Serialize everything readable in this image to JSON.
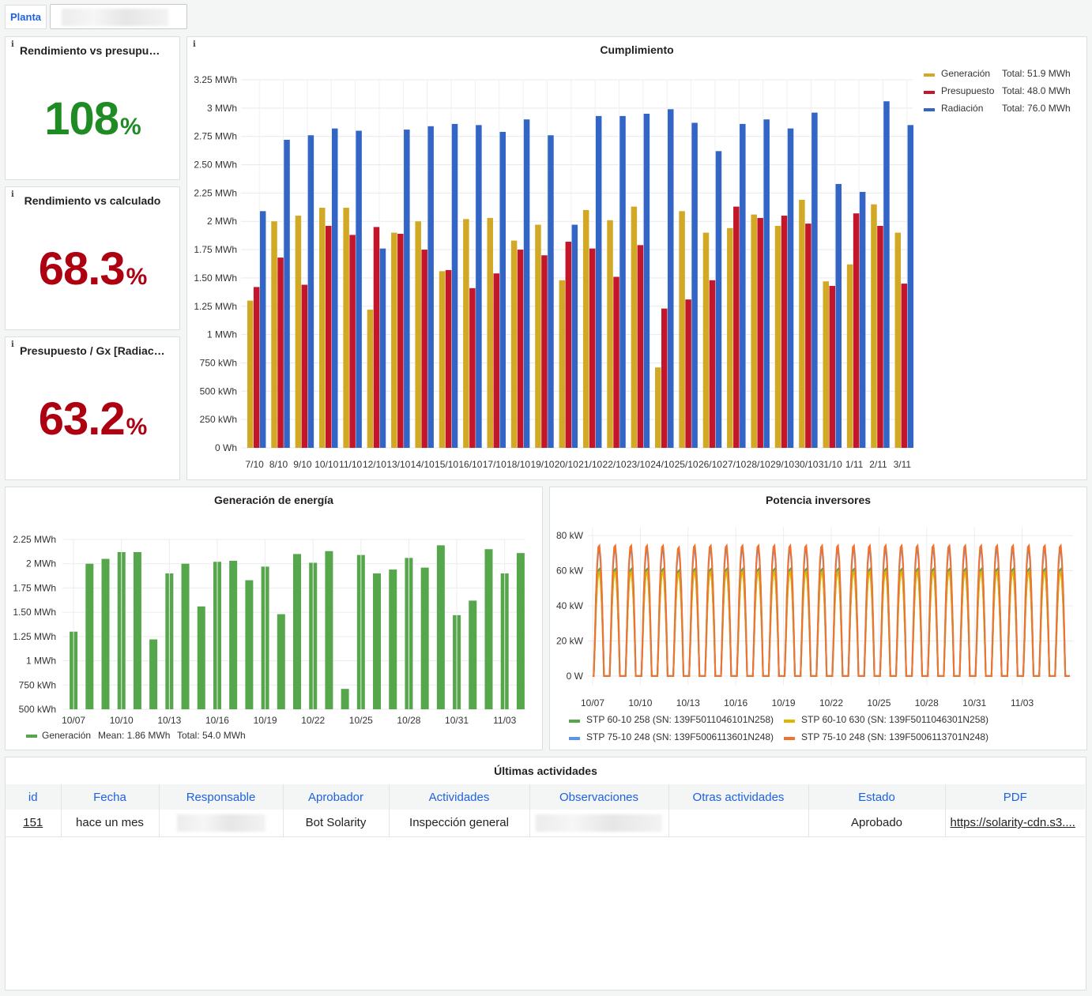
{
  "top": {
    "planta_label": "Planta"
  },
  "stats": [
    {
      "title": "Rendimiento vs presupues...",
      "value": "108",
      "unit": "%",
      "color": "#1f8b24"
    },
    {
      "title": "Rendimiento vs calculado",
      "value": "68.3",
      "unit": "%",
      "color": "#ad0011"
    },
    {
      "title": "Presupuesto / Gx [Radiaci...",
      "value": "63.2",
      "unit": "%",
      "color": "#ad0011"
    }
  ],
  "cumplimiento": {
    "title": "Cumplimiento",
    "chart_data": {
      "type": "bar",
      "categories": [
        "7/10",
        "8/10",
        "9/10",
        "10/10",
        "11/10",
        "12/10",
        "13/10",
        "14/10",
        "15/10",
        "16/10",
        "17/10",
        "18/10",
        "19/10",
        "20/10",
        "21/10",
        "22/10",
        "23/10",
        "24/10",
        "25/10",
        "26/10",
        "27/10",
        "28/10",
        "29/10",
        "30/10",
        "31/10",
        "1/11",
        "2/11",
        "3/11"
      ],
      "series": [
        {
          "name": "Generación",
          "color": "#d1a924",
          "total": "Total: 51.9 MWh",
          "values": [
            1.3,
            2.0,
            2.05,
            2.12,
            2.12,
            1.22,
            1.9,
            2.0,
            1.56,
            2.02,
            2.03,
            1.83,
            1.97,
            1.48,
            2.1,
            2.01,
            2.13,
            0.71,
            2.09,
            1.9,
            1.94,
            2.06,
            1.96,
            2.19,
            1.47,
            1.62,
            2.15,
            1.9
          ]
        },
        {
          "name": "Presupuesto",
          "color": "#c4162a",
          "total": "Total: 48.0 MWh",
          "values": [
            1.42,
            1.68,
            1.44,
            1.96,
            1.88,
            1.95,
            1.89,
            1.75,
            1.57,
            1.41,
            1.54,
            1.75,
            1.7,
            1.82,
            1.76,
            1.51,
            1.79,
            1.23,
            1.31,
            1.48,
            2.13,
            2.03,
            2.05,
            1.98,
            1.43,
            2.07,
            1.96,
            1.45
          ]
        },
        {
          "name": "Radiación",
          "color": "#3265c5",
          "total": "Total: 76.0 MWh",
          "values": [
            2.09,
            2.72,
            2.76,
            2.82,
            2.8,
            1.76,
            2.81,
            2.84,
            2.86,
            2.85,
            2.79,
            2.9,
            2.76,
            1.97,
            2.93,
            2.93,
            2.95,
            2.99,
            2.87,
            2.62,
            2.86,
            2.9,
            2.82,
            2.96,
            2.33,
            2.26,
            3.06,
            2.85
          ]
        }
      ],
      "ylim": [
        0,
        3.25
      ],
      "y_ticks": [
        "0 Wh",
        "250 kWh",
        "500 kWh",
        "750 kWh",
        "1 MWh",
        "1.25 MWh",
        "1.50 MWh",
        "1.75 MWh",
        "2 MWh",
        "2.25 MWh",
        "2.50 MWh",
        "2.75 MWh",
        "3 MWh",
        "3.25 MWh"
      ],
      "legend": "top-right",
      "grid": true
    }
  },
  "generacion": {
    "title": "Generación de energía",
    "chart_data": {
      "type": "bar",
      "x_labels": [
        "10/07",
        "10/10",
        "10/13",
        "10/16",
        "10/19",
        "10/22",
        "10/25",
        "10/28",
        "10/31",
        "11/03"
      ],
      "values": [
        1.3,
        2.0,
        2.05,
        2.12,
        2.12,
        1.22,
        1.9,
        2.0,
        1.56,
        2.02,
        2.03,
        1.83,
        1.97,
        1.48,
        2.1,
        2.01,
        2.13,
        0.71,
        2.09,
        1.9,
        1.94,
        2.06,
        1.96,
        2.19,
        1.47,
        1.62,
        2.15,
        1.9,
        2.11
      ],
      "color": "#56a64b",
      "ylim": [
        0.5,
        2.25
      ],
      "y_ticks": [
        "500 kWh",
        "750 kWh",
        "1 MWh",
        "1.25 MWh",
        "1.50 MWh",
        "1.75 MWh",
        "2 MWh",
        "2.25 MWh"
      ],
      "legend": {
        "name": "Generación",
        "mean": "Mean: 1.86 MWh",
        "total": "Total: 54.0 MWh"
      },
      "grid": true
    }
  },
  "potencia": {
    "title": "Potencia inversores",
    "chart_data": {
      "type": "line",
      "x_labels": [
        "10/07",
        "10/10",
        "10/13",
        "10/16",
        "10/19",
        "10/22",
        "10/25",
        "10/28",
        "10/31",
        "11/03"
      ],
      "y_ticks": [
        "0 W",
        "20 kW",
        "40 kW",
        "60 kW",
        "80 kW"
      ],
      "ylim": [
        -5,
        85
      ],
      "daily_peak_kw": [
        75,
        75,
        75,
        75,
        75,
        74,
        75,
        75,
        75,
        75,
        75,
        75,
        75,
        75,
        75,
        75,
        75,
        75,
        75,
        75,
        75,
        75,
        75,
        75,
        75,
        75,
        75,
        75,
        75,
        75
      ],
      "series": [
        {
          "name": "STP 60-10 258 (SN: 139F5011046101N258)",
          "color": "#56a64b"
        },
        {
          "name": "STP 60-10 630 (SN: 139F5011046301N258)",
          "color": "#e0b400"
        },
        {
          "name": "STP 75-10 248 (SN: 139F5006113601N248)",
          "color": "#5794f2"
        },
        {
          "name": "STP 75-10 248 (SN: 139F5006113701N248)",
          "color": "#f2722c"
        }
      ],
      "legend": "bottom",
      "grid": true
    }
  },
  "actividades": {
    "title": "Últimas actividades",
    "columns": [
      "id",
      "Fecha",
      "Responsable",
      "Aprobador",
      "Actividades",
      "Observaciones",
      "Otras actividades",
      "Estado",
      "PDF"
    ],
    "rows": [
      {
        "id": "151",
        "fecha": "hace un mes",
        "responsable": "",
        "aprobador": "Bot Solarity",
        "actividades": "Inspección general",
        "observaciones": "",
        "otras": "",
        "estado": "Aprobado",
        "pdf": "https://solarity-cdn.s3...."
      }
    ]
  }
}
